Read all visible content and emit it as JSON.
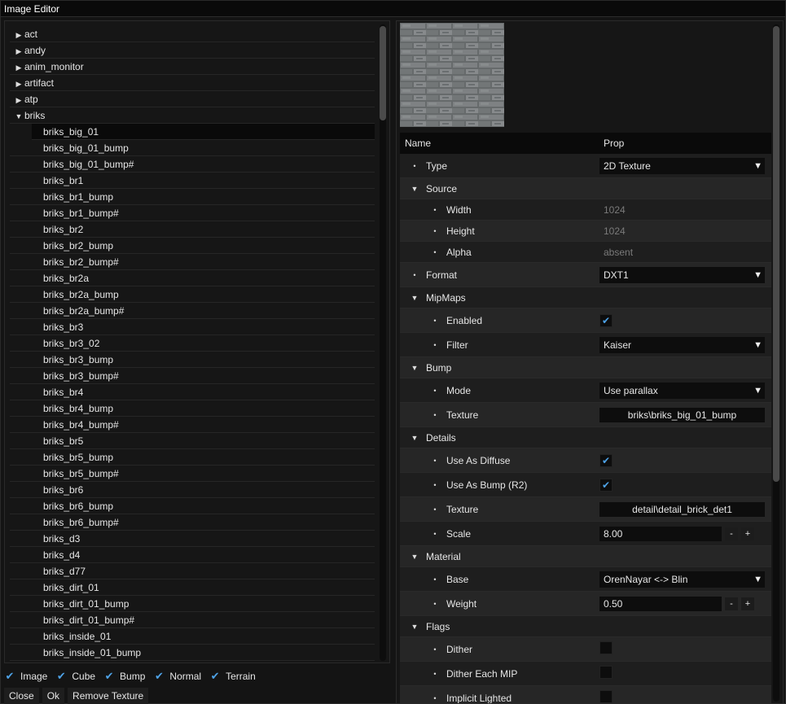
{
  "window": {
    "title": "Image Editor"
  },
  "tree": {
    "folders": [
      {
        "label": "act",
        "arrow": "▶"
      },
      {
        "label": "andy",
        "arrow": "▶"
      },
      {
        "label": "anim_monitor",
        "arrow": "▶"
      },
      {
        "label": "artifact",
        "arrow": "▶"
      },
      {
        "label": "atp",
        "arrow": "▶"
      },
      {
        "label": "briks",
        "arrow": "▼"
      }
    ],
    "items": [
      "briks_big_01",
      "briks_big_01_bump",
      "briks_big_01_bump#",
      "briks_br1",
      "briks_br1_bump",
      "briks_br1_bump#",
      "briks_br2",
      "briks_br2_bump",
      "briks_br2_bump#",
      "briks_br2a",
      "briks_br2a_bump",
      "briks_br2a_bump#",
      "briks_br3",
      "briks_br3_02",
      "briks_br3_bump",
      "briks_br3_bump#",
      "briks_br4",
      "briks_br4_bump",
      "briks_br4_bump#",
      "briks_br5",
      "briks_br5_bump",
      "briks_br5_bump#",
      "briks_br6",
      "briks_br6_bump",
      "briks_br6_bump#",
      "briks_d3",
      "briks_d4",
      "briks_d77",
      "briks_dirt_01",
      "briks_dirt_01_bump",
      "briks_dirt_01_bump#",
      "briks_inside_01",
      "briks_inside_01_bump"
    ],
    "selected": "briks_big_01"
  },
  "filters": [
    {
      "label": "Image",
      "checked": true
    },
    {
      "label": "Cube",
      "checked": true
    },
    {
      "label": "Bump",
      "checked": true
    },
    {
      "label": "Normal",
      "checked": true
    },
    {
      "label": "Terrain",
      "checked": true
    }
  ],
  "buttons": {
    "close": "Close",
    "ok": "Ok",
    "remove": "Remove Texture"
  },
  "props": {
    "header": {
      "name": "Name",
      "prop": "Prop"
    },
    "rows": [
      {
        "name": "Type",
        "level": 0,
        "mark": "•",
        "kind": "dropdown",
        "value": "2D Texture"
      },
      {
        "name": "Source",
        "level": 0,
        "mark": "▼",
        "kind": "group"
      },
      {
        "name": "Width",
        "level": 1,
        "mark": "•",
        "kind": "readonly",
        "value": "1024"
      },
      {
        "name": "Height",
        "level": 1,
        "mark": "•",
        "kind": "readonly",
        "value": "1024"
      },
      {
        "name": "Alpha",
        "level": 1,
        "mark": "•",
        "kind": "readonly",
        "value": "absent"
      },
      {
        "name": "Format",
        "level": 0,
        "mark": "•",
        "kind": "dropdown",
        "value": "DXT1"
      },
      {
        "name": "MipMaps",
        "level": 0,
        "mark": "▼",
        "kind": "group"
      },
      {
        "name": "Enabled",
        "level": 1,
        "mark": "•",
        "kind": "checkbox",
        "checked": true
      },
      {
        "name": "Filter",
        "level": 1,
        "mark": "•",
        "kind": "dropdown",
        "value": "Kaiser"
      },
      {
        "name": "Bump",
        "level": 0,
        "mark": "▼",
        "kind": "group"
      },
      {
        "name": "Mode",
        "level": 1,
        "mark": "•",
        "kind": "dropdown",
        "value": "Use parallax"
      },
      {
        "name": "Texture",
        "level": 1,
        "mark": "•",
        "kind": "text",
        "value": "briks\\briks_big_01_bump"
      },
      {
        "name": "Details",
        "level": 0,
        "mark": "▼",
        "kind": "group"
      },
      {
        "name": "Use As Diffuse",
        "level": 1,
        "mark": "•",
        "kind": "checkbox",
        "checked": true
      },
      {
        "name": "Use As Bump (R2)",
        "level": 1,
        "mark": "•",
        "kind": "checkbox",
        "checked": true
      },
      {
        "name": "Texture",
        "level": 1,
        "mark": "•",
        "kind": "text",
        "value": "detail\\detail_brick_det1"
      },
      {
        "name": "Scale",
        "level": 1,
        "mark": "•",
        "kind": "number",
        "value": "8.00"
      },
      {
        "name": "Material",
        "level": 0,
        "mark": "▼",
        "kind": "group"
      },
      {
        "name": "Base",
        "level": 1,
        "mark": "•",
        "kind": "dropdown",
        "value": "OrenNayar <-> Blin"
      },
      {
        "name": "Weight",
        "level": 1,
        "mark": "•",
        "kind": "number",
        "value": "0.50"
      },
      {
        "name": "Flags",
        "level": 0,
        "mark": "▼",
        "kind": "group"
      },
      {
        "name": "Dither",
        "level": 1,
        "mark": "•",
        "kind": "checkbox",
        "checked": false
      },
      {
        "name": "Dither Each MIP",
        "level": 1,
        "mark": "•",
        "kind": "checkbox",
        "checked": false
      },
      {
        "name": "Implicit Lighted",
        "level": 1,
        "mark": "•",
        "kind": "checkbox",
        "checked": false
      }
    ]
  },
  "icons": {
    "check": "check-icon",
    "expanded": "triangle-down-icon",
    "collapsed": "triangle-right-icon",
    "bullet": "bullet-icon",
    "dropdown": "dropdown-arrow-icon"
  },
  "colors": {
    "accent": "#4ea3e8",
    "background": "#141414"
  }
}
